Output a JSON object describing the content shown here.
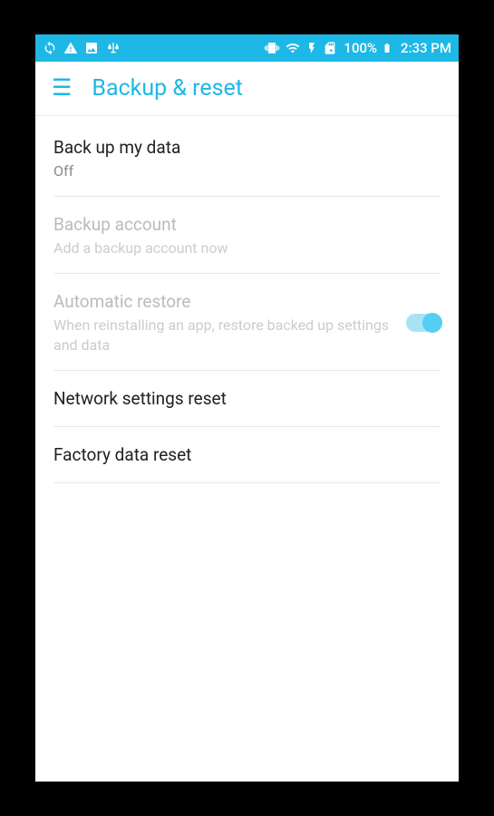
{
  "status_bar": {
    "battery": "100%",
    "time": "2:33 PM"
  },
  "header": {
    "title": "Backup & reset"
  },
  "settings": {
    "backup_data": {
      "title": "Back up my data",
      "subtitle": "Off"
    },
    "backup_account": {
      "title": "Backup account",
      "subtitle": "Add a backup account now"
    },
    "auto_restore": {
      "title": "Automatic restore",
      "subtitle": "When reinstalling an app, restore backed up settings and data"
    },
    "network_reset": {
      "title": "Network settings reset"
    },
    "factory_reset": {
      "title": "Factory data reset"
    }
  }
}
